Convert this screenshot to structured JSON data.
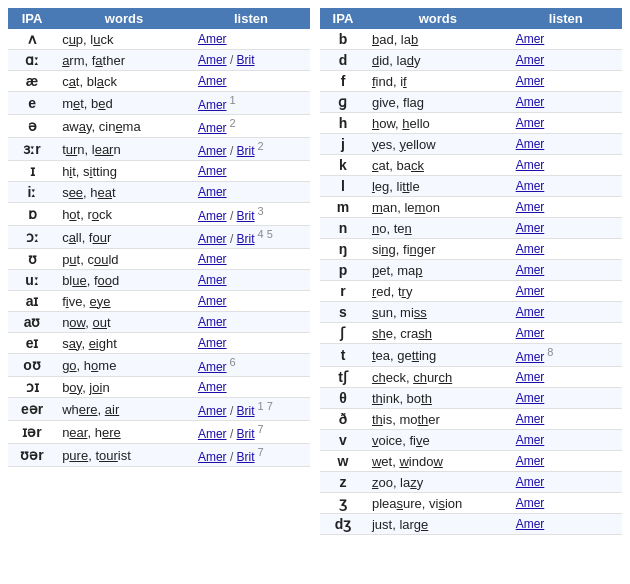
{
  "left_table": {
    "headers": [
      "IPA",
      "words",
      "listen"
    ],
    "rows": [
      {
        "ipa": "ʌ",
        "words": "c<u>u</u>p, l<u>u</u>ck",
        "words_plain": "cup, luck",
        "words_u1": "u",
        "words_u2": "u",
        "listen": "Amer",
        "brit": null,
        "note": null
      },
      {
        "ipa": "ɑː",
        "words": "<u>a</u>rm, f<u>a</u>ther",
        "words_plain": "arm, father",
        "listen": "Amer",
        "brit": "Brit",
        "note": null
      },
      {
        "ipa": "æ",
        "words": "c<u>a</u>t, bl<u>a</u>ck",
        "words_plain": "cat, black",
        "listen": "Amer",
        "brit": null,
        "note": null
      },
      {
        "ipa": "e",
        "words": "m<u>e</u>t, b<u>e</u>d",
        "words_plain": "met, bed",
        "listen": "Amer",
        "brit": null,
        "note": "1"
      },
      {
        "ipa": "ə",
        "words": "aw<u>a</u>y, cin<u>e</u>ma",
        "words_plain": "away, cinema",
        "listen": "Amer",
        "brit": null,
        "note": "2"
      },
      {
        "ipa": "ɜːr",
        "words": "t<u>ur</u>n, l<u>ear</u>n",
        "words_plain": "turn, learn",
        "listen": "Amer",
        "brit": "Brit",
        "note": "2"
      },
      {
        "ipa": "ɪ",
        "words": "h<u>i</u>t, s<u>i</u>tting",
        "words_plain": "hit, sitting",
        "listen": "Amer",
        "brit": null,
        "note": null
      },
      {
        "ipa": "iː",
        "words": "s<u>ee</u>, h<u>ea</u>t",
        "words_plain": "see, heat",
        "listen": "Amer",
        "brit": null,
        "note": null
      },
      {
        "ipa": "ɒ",
        "words": "h<u>o</u>t, r<u>o</u>ck",
        "words_plain": "hot, rock",
        "listen": "Amer",
        "brit": "Brit",
        "note": "3"
      },
      {
        "ipa": "ɔː",
        "words": "c<u>a</u>ll, f<u>ou</u>r",
        "words_plain": "call, four",
        "listen": "Amer",
        "brit": "Brit",
        "note": "4 5"
      },
      {
        "ipa": "ʊ",
        "words": "p<u>u</u>t, c<u>ou</u>ld",
        "words_plain": "put, could",
        "listen": "Amer",
        "brit": null,
        "note": null
      },
      {
        "ipa": "uː",
        "words": "bl<u>ue</u>, f<u>oo</u>d",
        "words_plain": "blue, food",
        "listen": "Amer",
        "brit": null,
        "note": null
      },
      {
        "ipa": "aɪ",
        "words": "f<u>i</u>ve, <u>eye</u>",
        "words_plain": "five, eye",
        "listen": "Amer",
        "brit": null,
        "note": null
      },
      {
        "ipa": "aʊ",
        "words": "n<u>ow</u>, <u>ou</u>t",
        "words_plain": "now, out",
        "listen": "Amer",
        "brit": null,
        "note": null
      },
      {
        "ipa": "eɪ",
        "words": "s<u>ay</u>, <u>ei</u>ght",
        "words_plain": "say, eight",
        "listen": "Amer",
        "brit": null,
        "note": null
      },
      {
        "ipa": "oʊ",
        "words": "g<u>o</u>, h<u>o</u>me",
        "words_plain": "go, home",
        "listen": "Amer",
        "brit": null,
        "note": "6"
      },
      {
        "ipa": "ɔɪ",
        "words": "b<u>oy</u>, j<u>oi</u>n",
        "words_plain": "boy, join",
        "listen": "Amer",
        "brit": null,
        "note": null
      },
      {
        "ipa": "eər",
        "words": "wh<u>ere</u>, <u>air</u>",
        "words_plain": "where, air",
        "listen": "Amer",
        "brit": "Brit",
        "note": "1 7"
      },
      {
        "ipa": "ɪər",
        "words": "n<u>ear</u>, h<u>ere</u>",
        "words_plain": "near, here",
        "listen": "Amer",
        "brit": "Brit",
        "note": "7"
      },
      {
        "ipa": "ʊər",
        "words": "p<u>ure</u>, t<u>our</u>ist",
        "words_plain": "pure, tourist",
        "listen": "Amer",
        "brit": "Brit",
        "note": "7"
      }
    ]
  },
  "right_table": {
    "headers": [
      "IPA",
      "words",
      "listen"
    ],
    "rows": [
      {
        "ipa": "b",
        "words": "<u>b</u>ad, la<u>b</u>",
        "words_plain": "bad, lab",
        "listen": "Amer",
        "brit": null,
        "note": null
      },
      {
        "ipa": "d",
        "words": "<u>d</u>i<u>d</u>, la<u>d</u>y",
        "words_plain": "did, lady",
        "listen": "Amer",
        "brit": null,
        "note": null
      },
      {
        "ipa": "f",
        "words": "<u>f</u>ind, i<u>f</u>",
        "words_plain": "find, if",
        "listen": "Amer",
        "brit": null,
        "note": null
      },
      {
        "ipa": "ɡ",
        "words": "<u>g</u>ive, fla<u>g</u>",
        "words_plain": "give, flag",
        "listen": "Amer",
        "brit": null,
        "note": null
      },
      {
        "ipa": "h",
        "words": "<u>h</u>ow, <u>h</u>ello",
        "words_plain": "how, hello",
        "listen": "Amer",
        "brit": null,
        "note": null
      },
      {
        "ipa": "j",
        "words": "<u>y</u>es, <u>y</u>ellow",
        "words_plain": "yes, yellow",
        "listen": "Amer",
        "brit": null,
        "note": null
      },
      {
        "ipa": "k",
        "words": "<u>c</u>at, ba<u>ck</u>",
        "words_plain": "cat, back",
        "listen": "Amer",
        "brit": null,
        "note": null
      },
      {
        "ipa": "l",
        "words": "<u>l</u>eg, <u>l</u>itt<u>l</u>e",
        "words_plain": "leg, little",
        "listen": "Amer",
        "brit": null,
        "note": null
      },
      {
        "ipa": "m",
        "words": "<u>m</u>an, le<u>m</u>on",
        "words_plain": "man, lemon",
        "listen": "Amer",
        "brit": null,
        "note": null
      },
      {
        "ipa": "n",
        "words": "<u>n</u>o, te<u>n</u>",
        "words_plain": "no, ten",
        "listen": "Amer",
        "brit": null,
        "note": null
      },
      {
        "ipa": "ŋ",
        "words": "si<u>ng</u>, fi<u>ng</u>er",
        "words_plain": "sing, finger",
        "listen": "Amer",
        "brit": null,
        "note": null
      },
      {
        "ipa": "p",
        "words": "<u>p</u>et, ma<u>p</u>",
        "words_plain": "pet, map",
        "listen": "Amer",
        "brit": null,
        "note": null
      },
      {
        "ipa": "r",
        "words": "<u>r</u>ed, t<u>r</u>y",
        "words_plain": "red, try",
        "listen": "Amer",
        "brit": null,
        "note": null
      },
      {
        "ipa": "s",
        "words": "<u>s</u>un, mi<u>ss</u>",
        "words_plain": "sun, miss",
        "listen": "Amer",
        "brit": null,
        "note": null
      },
      {
        "ipa": "ʃ",
        "words": "<u>sh</u>e, cra<u>sh</u>",
        "words_plain": "she, crash",
        "listen": "Amer",
        "brit": null,
        "note": null
      },
      {
        "ipa": "t",
        "words": "<u>t</u>ea, ge<u>tt</u>ing",
        "words_plain": "tea, getting",
        "listen": "Amer",
        "brit": null,
        "note": "8"
      },
      {
        "ipa": "tʃ",
        "words": "<u>ch</u>eck, <u>ch</u>ur<u>ch</u>",
        "words_plain": "check, church",
        "listen": "Amer",
        "brit": null,
        "note": null
      },
      {
        "ipa": "θ",
        "words": "<u>th</u>ink, bo<u>th</u>",
        "words_plain": "think, both",
        "listen": "Amer",
        "brit": null,
        "note": null
      },
      {
        "ipa": "ð",
        "words": "<u>th</u>is, mo<u>th</u>er",
        "words_plain": "this, mother",
        "listen": "Amer",
        "brit": null,
        "note": null
      },
      {
        "ipa": "v",
        "words": "<u>v</u>oice, fi<u>v</u>e",
        "words_plain": "voice, five",
        "listen": "Amer",
        "brit": null,
        "note": null
      },
      {
        "ipa": "w",
        "words": "<u>w</u>et, <u>w</u>indo<u>w</u>",
        "words_plain": "wet, window",
        "listen": "Amer",
        "brit": null,
        "note": null
      },
      {
        "ipa": "z",
        "words": "<u>z</u>oo, la<u>z</u>y",
        "words_plain": "zoo, lazy",
        "listen": "Amer",
        "brit": null,
        "note": null
      },
      {
        "ipa": "ʒ",
        "words": "plea<u>s</u>ure, vi<u>s</u>ion",
        "words_plain": "pleasure, vision",
        "listen": "Amer",
        "brit": null,
        "note": null
      },
      {
        "ipa": "dʒ",
        "words": "<u>j</u>ust, lar<u>ge</u>",
        "words_plain": "just, large",
        "listen": "Amer",
        "brit": null,
        "note": null
      }
    ]
  },
  "labels": {
    "amer": "Amer",
    "brit": "Brit",
    "separator": " / "
  }
}
